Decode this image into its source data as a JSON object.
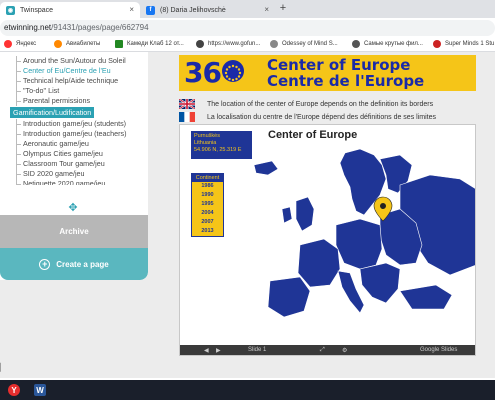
{
  "browser": {
    "tabs": [
      {
        "title": "Twinspace",
        "favicon": "twinspace-icon",
        "active": true
      },
      {
        "title": "(8) Daria Jelihovschė",
        "favicon": "facebook-icon",
        "active": false
      }
    ],
    "tab_close": "×",
    "new_tab": "+",
    "url": {
      "host": "etwinning.net",
      "path": "/91431/pages/page/662794"
    },
    "bookmarks": [
      {
        "label": "Яндекс",
        "color": "#f33"
      },
      {
        "label": "Авиабилеты",
        "color": "#f80"
      },
      {
        "label": "Камеди Клаб 12 от...",
        "color": "#282"
      },
      {
        "label": "https://www.gofun...",
        "color": "#444"
      },
      {
        "label": "Odessey of Mind S...",
        "color": "#888"
      },
      {
        "label": "Самые крутые фил...",
        "color": "#555"
      },
      {
        "label": "Super Minds 1 Stu",
        "color": "#c22"
      }
    ]
  },
  "sidebar": {
    "items_top": [
      {
        "label": "Around the Sun/Autour du Soleil",
        "active": false
      },
      {
        "label": "Center of Eu/Centre de l'Eu",
        "active": true
      },
      {
        "label": "Technical help/Aide technique",
        "active": false
      },
      {
        "label": "\"To-do\" List",
        "active": false
      },
      {
        "label": "Parental permissions",
        "active": false
      }
    ],
    "section_heading": "Gamification/Ludification",
    "items_bottom": [
      {
        "label": "Introduction game/jeu (students)"
      },
      {
        "label": "Introduction game/jeu (teachers)"
      },
      {
        "label": "Aeronautic game/jeu"
      },
      {
        "label": "Olympus Cities game/jeu"
      },
      {
        "label": "Classroom Tour game/jeu"
      },
      {
        "label": "SID 2020 game/jeu"
      },
      {
        "label": "Netiquette 2020 game/jeu"
      }
    ],
    "archive_label": "Archive",
    "create_label": "Create a page"
  },
  "content": {
    "banner_logo": "360",
    "banner_line1": "Center of Europe",
    "banner_line2": "Centre de l'Europe",
    "text_en": "The location of the center of Europe depends on the definition its borders",
    "text_fr": "La localisation du centre de l'Europe dépend des définitions de ses limites",
    "map": {
      "title": "Center of Europe",
      "place_box": [
        "Purnuškės",
        "Lithuania",
        "54.906 N, 25.319 E"
      ],
      "continent_heading": "Continent",
      "years": [
        "1986",
        "1990",
        "1995",
        "2004",
        "2007",
        "2013"
      ],
      "slide_label": "Slide 1",
      "footer_brand": "Google Slides"
    }
  },
  "colors": {
    "accent": "#2ba1b3",
    "banner_yellow": "#f5c518",
    "banner_blue": "#1a2aa8",
    "map_blue": "#1f3596",
    "archive_gray": "#b7b7b7",
    "create_teal": "#5ab7bf"
  },
  "taskbar": {
    "apps": [
      {
        "icon": "yandex-browser-icon",
        "label": "Y"
      },
      {
        "icon": "word-icon",
        "label": "W"
      }
    ]
  }
}
